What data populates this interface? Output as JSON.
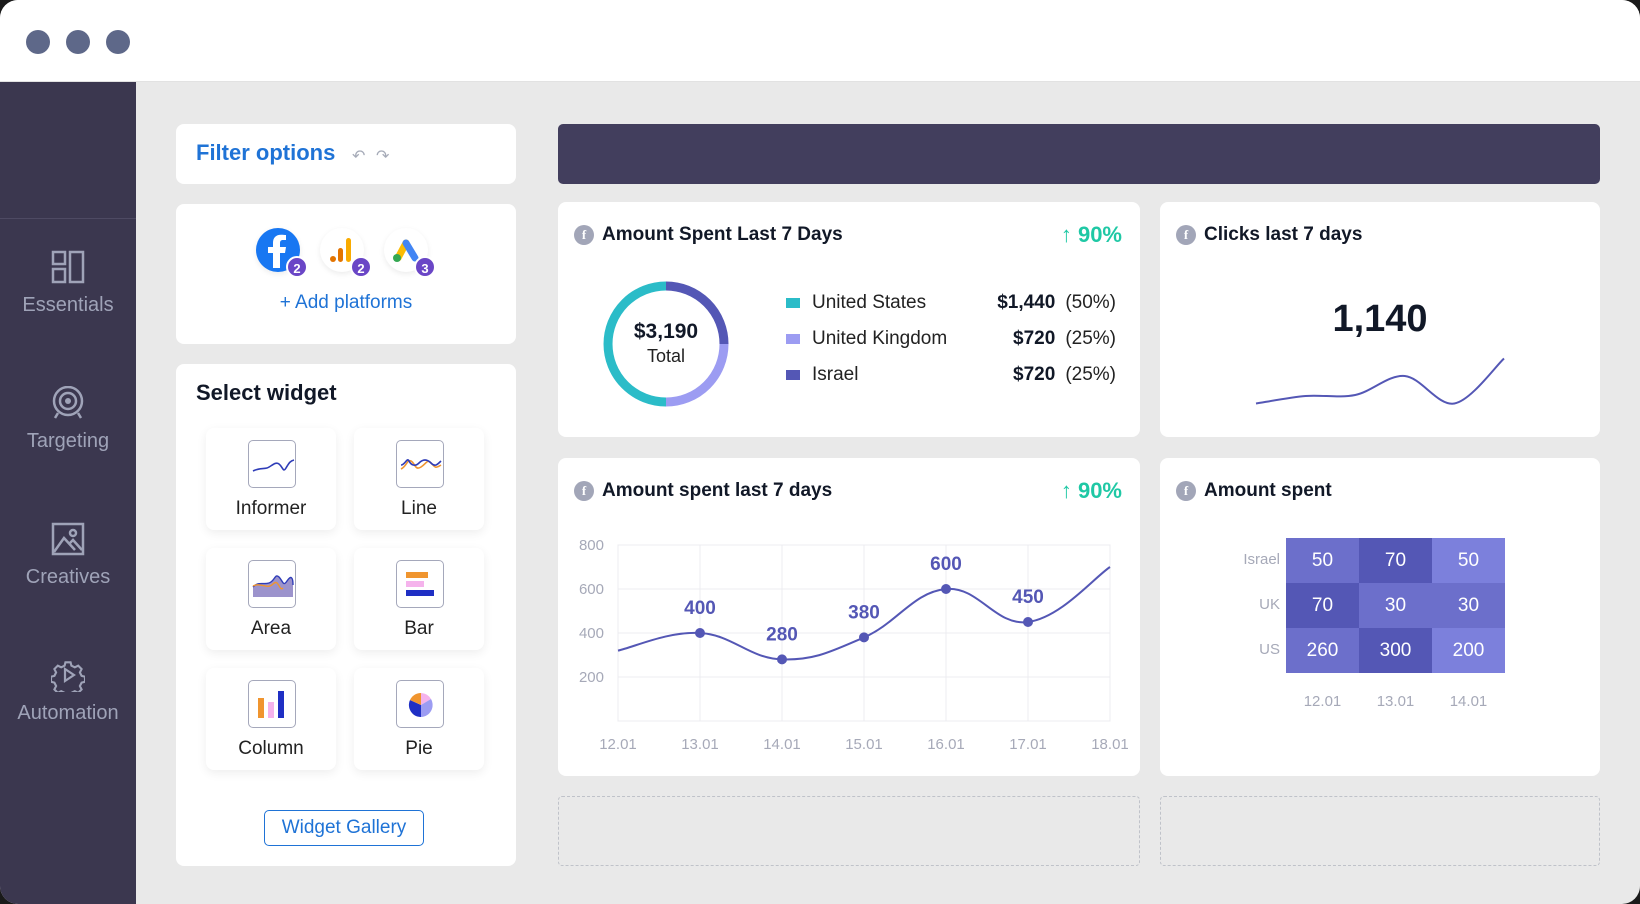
{
  "window": {
    "controls": [
      "close",
      "minimize",
      "maximize"
    ]
  },
  "sidebar": {
    "items": [
      {
        "label": "Essentials",
        "icon": "layout-icon"
      },
      {
        "label": "Targeting",
        "icon": "target-icon"
      },
      {
        "label": "Creatives",
        "icon": "image-icon"
      },
      {
        "label": "Automation",
        "icon": "automation-gear-icon"
      }
    ]
  },
  "filter": {
    "title": "Filter options",
    "undo": "↶",
    "redo": "↷"
  },
  "platforms": {
    "items": [
      {
        "name": "Facebook",
        "count": "2"
      },
      {
        "name": "Google Analytics",
        "count": "2"
      },
      {
        "name": "Google Ads",
        "count": "3"
      }
    ],
    "add_label": "+ Add platforms"
  },
  "widgets": {
    "title": "Select widget",
    "items": [
      {
        "label": "Informer"
      },
      {
        "label": "Line"
      },
      {
        "label": "Area"
      },
      {
        "label": "Bar"
      },
      {
        "label": "Column"
      },
      {
        "label": "Pie"
      }
    ],
    "gallery_label": "Widget Gallery"
  },
  "colors": {
    "accent": "#1f73d6",
    "trend": "#1fc8a5",
    "series": "#5457b5",
    "us": "#2bbcc8",
    "uk": "#9c9cf2",
    "israel": "#5457b5"
  },
  "spent_card": {
    "title": "Amount Spent Last 7 Days",
    "trend": "↑ 90%",
    "total": "$3,190",
    "total_label": "Total",
    "legend": [
      {
        "name": "United States",
        "value": "$1,440",
        "pct": "(50%)",
        "color": "#2bbcc8"
      },
      {
        "name": "United Kingdom",
        "value": "$720",
        "pct": "(25%)",
        "color": "#9c9cf2"
      },
      {
        "name": "Israel",
        "value": "$720",
        "pct": "(25%)",
        "color": "#5457b5"
      }
    ]
  },
  "clicks_card": {
    "title": "Clicks last 7 days",
    "value": "1,140"
  },
  "line_card": {
    "title": "Amount spent last 7 days",
    "trend": "↑ 90%"
  },
  "heatmap_card": {
    "title": "Amount spent"
  },
  "chart_data": [
    {
      "type": "pie",
      "title": "Amount Spent Last 7 Days",
      "categories": [
        "United States",
        "United Kingdom",
        "Israel"
      ],
      "values": [
        1440,
        720,
        720
      ],
      "total": 3190
    },
    {
      "type": "line",
      "title": "Clicks last 7 days",
      "values": [
        0.05,
        0.2,
        0.22,
        0.6,
        0.05,
        0.95
      ]
    },
    {
      "type": "line",
      "title": "Amount spent last 7 days",
      "x": [
        "12.01",
        "13.01",
        "14.01",
        "15.01",
        "16.01",
        "17.01",
        "18.01"
      ],
      "series": [
        {
          "name": "Amount spent",
          "values": [
            320,
            400,
            280,
            380,
            600,
            450,
            700
          ]
        }
      ],
      "labeled_points": [
        1,
        2,
        3,
        4,
        5
      ],
      "yticks": [
        200,
        400,
        600,
        800
      ],
      "ylim": [
        0,
        800
      ],
      "grid": true
    },
    {
      "type": "heatmap",
      "title": "Amount spent",
      "rows": [
        "Israel",
        "UK",
        "US"
      ],
      "columns": [
        "12.01",
        "13.01",
        "14.01"
      ],
      "values": [
        [
          50,
          70,
          50
        ],
        [
          70,
          30,
          30
        ],
        [
          260,
          300,
          200
        ]
      ],
      "cell_colors": [
        [
          "#6c6fcb",
          "#5457b5",
          "#7c80dc"
        ],
        [
          "#5457b5",
          "#6c6fcb",
          "#6c6fcb"
        ],
        [
          "#6c6fcb",
          "#5457b5",
          "#7c80dc"
        ]
      ]
    }
  ]
}
